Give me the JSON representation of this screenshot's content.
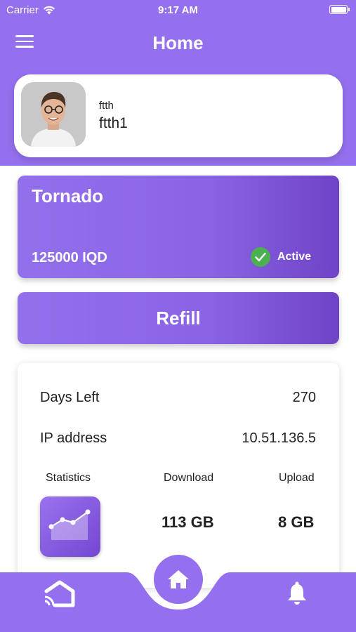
{
  "status_bar": {
    "carrier": "Carrier",
    "time": "9:17 AM",
    "icons": [
      "wifi-icon",
      "battery-icon"
    ]
  },
  "nav": {
    "title": "Home",
    "menu_icon": "hamburger-menu-icon"
  },
  "profile": {
    "subtitle": "ftth",
    "name": "ftth1"
  },
  "plan": {
    "name": "Tornado",
    "price": "125000 IQD",
    "status": "Active",
    "status_icon": "check-circle-icon"
  },
  "refill": {
    "label": "Refill"
  },
  "info": {
    "days_left_label": "Days Left",
    "days_left_value": "270",
    "ip_label": "IP address",
    "ip_value": "10.51.136.5",
    "stats_label": "Statistics",
    "download_label": "Download",
    "upload_label": "Upload",
    "download_value": "113 GB",
    "upload_value": "8 GB"
  },
  "bottom_nav": {
    "left_icon": "ftth-home-logo-icon",
    "center_icon": "home-icon",
    "right_icon": "bell-icon"
  },
  "colors": {
    "primary": "#9470ee",
    "primary_dark": "#6f43c6",
    "active_green": "#4caf50"
  }
}
